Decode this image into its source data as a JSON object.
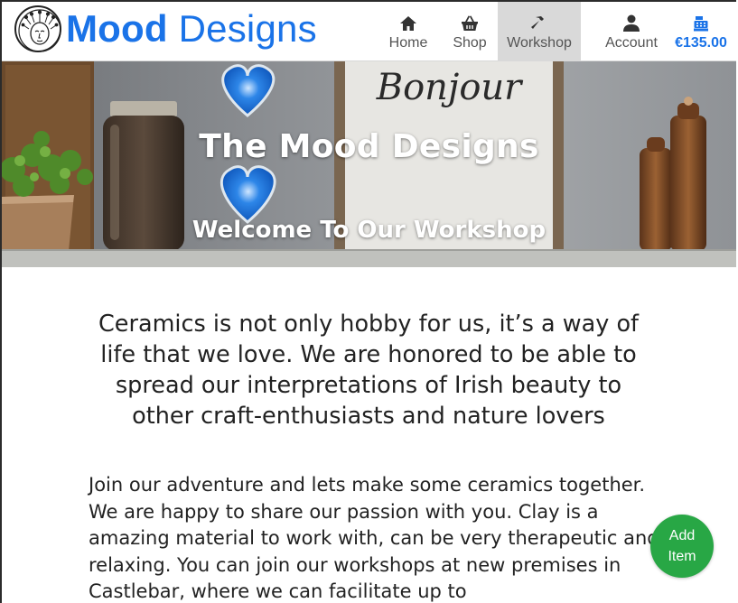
{
  "header": {
    "brand": {
      "word1": "Mood",
      "word2": "Designs"
    },
    "nav": {
      "home": {
        "label": "Home",
        "icon": "home-icon"
      },
      "shop": {
        "label": "Shop",
        "icon": "basket-icon"
      },
      "workshop": {
        "label": "Workshop",
        "icon": "hammer-icon",
        "active": true
      },
      "account": {
        "label": "Account",
        "icon": "user-icon"
      },
      "bag": {
        "label": "€135.00",
        "icon": "cash-register-icon"
      }
    }
  },
  "hero": {
    "title": "The Mood Designs",
    "subtitle": "Welcome To Our Workshop",
    "sign_text": "Bonjour"
  },
  "main": {
    "lead": "Ceramics is not only hobby for us, it’s a way of life that we love. We are honored to be able to spread our interpretations of Irish beauty to other craft-enthusiasts and nature lovers",
    "paragraph": "Join our adventure and lets make some ceramics together. We are happy to share our passion with you. Clay is a amazing material to work with, can be very therapeutic and relaxing. You can join our workshops at new premises in Castlebar, where we can facilitate up to"
  },
  "fab": {
    "line1": "Add",
    "line2": "Item"
  },
  "colors": {
    "brand": "#1a73e8",
    "fab": "#28a745",
    "active_nav": "#d9d9d9"
  }
}
